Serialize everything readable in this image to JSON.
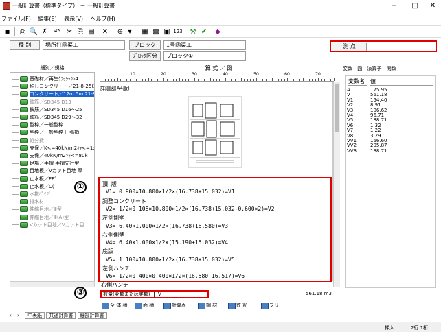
{
  "window": {
    "title": "一般計算書（標準タイプ） － 一般計算書",
    "minimize": "−",
    "maximize": "□",
    "close": "✕"
  },
  "menu": [
    "ファイル(F)",
    "編集(E)",
    "表示(V)",
    "ヘルプ(H)"
  ],
  "toolbar": {
    "icons": [
      "save-icon",
      "print-icon",
      "preview-icon",
      "delete-icon",
      "undo-icon",
      "cut-icon",
      "copy-icon",
      "paste-icon",
      "clear-icon",
      "insert-icon",
      "table-icon",
      "chart-icon",
      "grid-icon",
      "number-icon",
      "tool-icon",
      "check-icon",
      "settings-icon"
    ],
    "number_label": "123"
  },
  "header": {
    "kind_label": "種 別",
    "kind_value": "場所打函渠工",
    "block_label": "ブロック",
    "block_value": "1号函渠工",
    "block_div_label": "ﾌﾞﾛｯｸ区分",
    "block_div_value": "ブロック①",
    "measure_label": "測 点",
    "measure_value": ""
  },
  "tree": {
    "heading": "細別／規格",
    "items": [
      {
        "label": "基礎材／再生ｸﾗｯｼｬﾗﾝ4",
        "state": "normal"
      },
      {
        "label": "均しコンクリート／21-8-25(2",
        "state": "normal"
      },
      {
        "label": "コンクリート／12m 5m 21-8",
        "state": "selected"
      },
      {
        "label": "鉄筋／SD345 D13",
        "state": "grey"
      },
      {
        "label": "鉄筋／SD345 D16〜25",
        "state": "normal"
      },
      {
        "label": "鉄筋／SD345 D29〜32",
        "state": "normal"
      },
      {
        "label": "型枠／一般型枠",
        "state": "normal"
      },
      {
        "label": "型枠／一般型枠 円弧指",
        "state": "normal"
      },
      {
        "label": "処分費",
        "state": "grey"
      },
      {
        "label": "支保／K<=40kN/m2ｷｬ<=1:",
        "state": "normal"
      },
      {
        "label": "支保／40kN/m2ｷｬ<=80k",
        "state": "normal"
      },
      {
        "label": "足場／手摺 手摺先行型",
        "state": "normal"
      },
      {
        "label": "目地板／Vカット目地 厚",
        "state": "normal"
      },
      {
        "label": "止水板／FF°",
        "state": "normal"
      },
      {
        "label": "止水板／C(",
        "state": "normal"
      },
      {
        "label": "水抜ﾊﾟｲﾌﾟ",
        "state": "grey"
      },
      {
        "label": "排水材",
        "state": "grey"
      },
      {
        "label": "伸縮目地／Ⅲ型",
        "state": "grey"
      },
      {
        "label": "伸縮目地／Ⅲ(A)型",
        "state": "grey"
      },
      {
        "label": "Vカット目地／Vカット目",
        "state": "grey"
      }
    ]
  },
  "center": {
    "heading": "算 式 ／ 図",
    "ruler_ticks": [
      "10",
      "20",
      "30",
      "40",
      "50",
      "60",
      "70"
    ],
    "drawing_caption": "詳細図(A4版)",
    "formula_lines": [
      "頂 版",
      "  'V1='0.900×10.800×1/2×(16.738+15.032)=V1",
      "調整コンクリート",
      "  'V2='1/2×0.108×10.800×1/2×(16.738+15.032-0.600×2)=V2",
      "左側側壁",
      "  'V3='6.40×1.000×1/2×(16.738+16.580)=V3",
      "右側側壁",
      "  'V4='6.40×1.000×1/2×(15.190+15.032)=V4",
      "底版",
      "  'V5='1.100×10.800×1/2×(16.738+15.032)=V5",
      "左側ハンチ",
      "  'V6='1/2×0.400×0.400×1/2×(16.580+16.517)=V6",
      "右側ハンチ"
    ],
    "count_label": "数量(変数または実数)",
    "count_value": "V",
    "total_value": "561.18 m3",
    "buttons": [
      "全 体 積",
      "面 積",
      "計算表",
      "鋼 材",
      "鉄 筋",
      "フリー"
    ]
  },
  "right": {
    "tabs": [
      "変数",
      "図",
      "演算子",
      "関数"
    ],
    "col_name": "変数名",
    "col_value": "値",
    "rows": [
      {
        "name": "A",
        "value": "175.95"
      },
      {
        "name": "V",
        "value": "561.18"
      },
      {
        "name": "V1",
        "value": "154.40"
      },
      {
        "name": "V2",
        "value": "8.91"
      },
      {
        "name": "V3",
        "value": "106.62"
      },
      {
        "name": "V4",
        "value": "96.71"
      },
      {
        "name": "V5",
        "value": "188.71"
      },
      {
        "name": "V6",
        "value": "1.32"
      },
      {
        "name": "V7",
        "value": "1.22"
      },
      {
        "name": "V8",
        "value": "3.29"
      },
      {
        "name": "VV1",
        "value": "166.60"
      },
      {
        "name": "VV2",
        "value": "205.87"
      },
      {
        "name": "VV3",
        "value": "188.71"
      }
    ]
  },
  "sheets": [
    "中表紙",
    "共通計算書",
    "細部計算書"
  ],
  "status": {
    "mode": "挿入",
    "pos": "2行 1桁"
  },
  "markers": [
    "①",
    "③"
  ]
}
